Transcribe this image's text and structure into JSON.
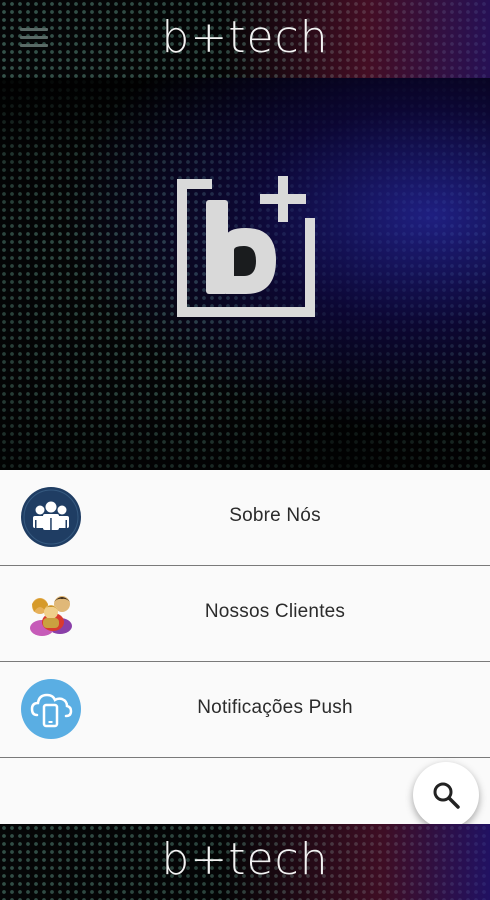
{
  "header": {
    "brand": "b+tech",
    "menu_icon": "hamburger-menu-icon"
  },
  "hero": {
    "logo_icon": "b-plus-logo"
  },
  "menu": {
    "items": [
      {
        "label": "Sobre Nós",
        "icon": "team-icon"
      },
      {
        "label": "Nossos Clientes",
        "icon": "clients-icon"
      },
      {
        "label": "Notificações Push",
        "icon": "cloud-phone-icon"
      }
    ]
  },
  "search": {
    "icon": "search-icon"
  },
  "footer": {
    "brand": "b+tech"
  },
  "colors": {
    "team_icon_bg": "#1f3d63",
    "push_icon_bg": "#5aaee3",
    "list_bg": "#fafafa"
  }
}
